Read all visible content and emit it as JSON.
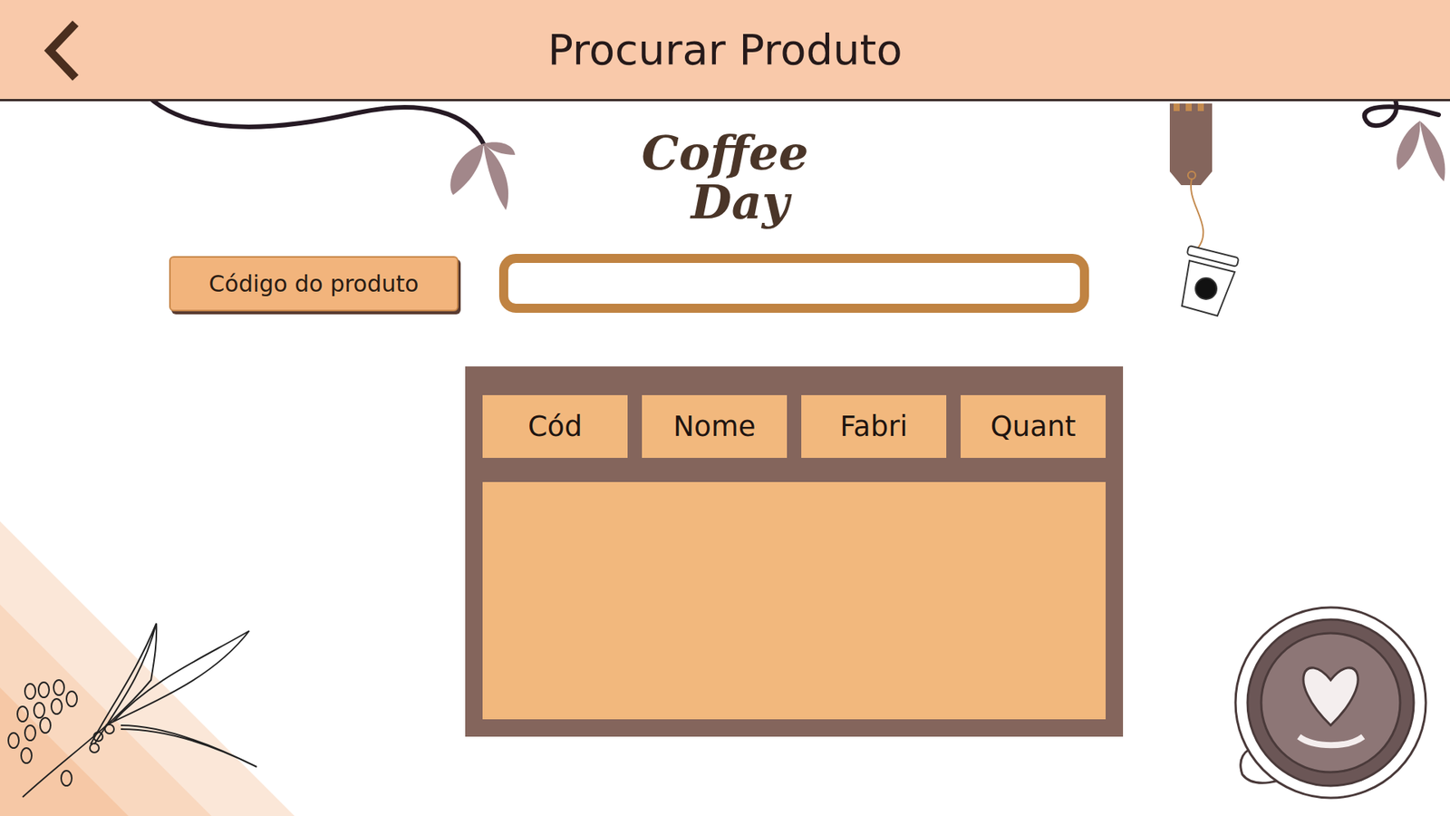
{
  "window": {
    "title": "Procurar Produto"
  },
  "logo": {
    "lines": [
      "Coffee",
      "Day"
    ]
  },
  "search": {
    "label": "Código do produto",
    "value": ""
  },
  "table": {
    "columns": [
      "Cód",
      "Nome",
      "Fabri",
      "Quant"
    ],
    "rows": []
  }
}
